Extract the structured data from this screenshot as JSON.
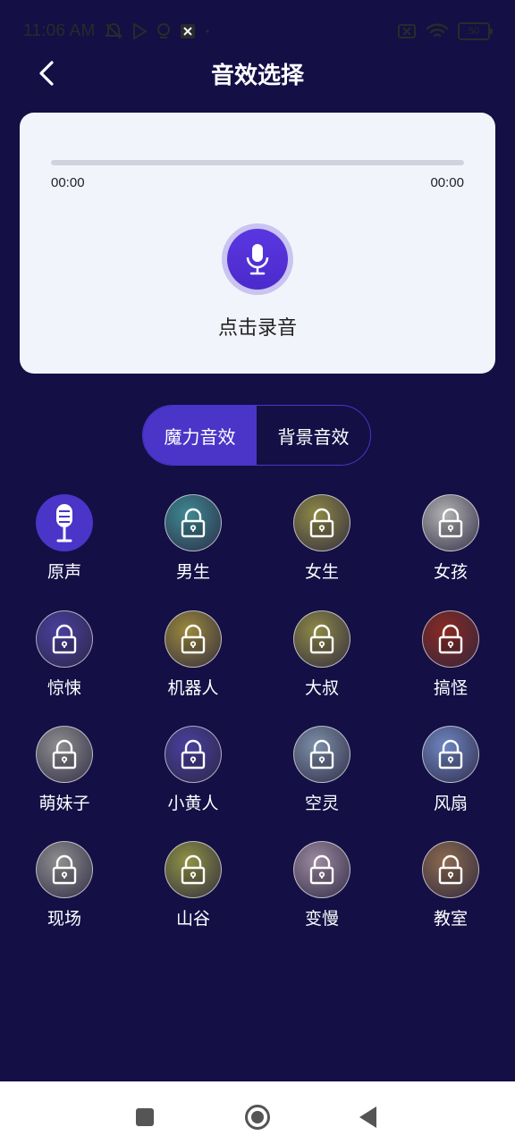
{
  "status": {
    "time": "11:06 AM",
    "battery": "50"
  },
  "header": {
    "title": "音效选择"
  },
  "recorder": {
    "time_start": "00:00",
    "time_end": "00:00",
    "label": "点击录音"
  },
  "tabs": [
    {
      "label": "魔力音效",
      "active": true
    },
    {
      "label": "背景音效",
      "active": false
    }
  ],
  "effects": [
    {
      "label": "原声",
      "color": "#4a35c8"
    },
    {
      "label": "男生",
      "color": "#3e8a93"
    },
    {
      "label": "女生",
      "color": "#8f8a45"
    },
    {
      "label": "女孩",
      "color": "#b3b3b3"
    },
    {
      "label": "惊悚",
      "color": "#4a3f9e"
    },
    {
      "label": "机器人",
      "color": "#9c8a3c"
    },
    {
      "label": "大叔",
      "color": "#8f8a45"
    },
    {
      "label": "搞怪",
      "color": "#8a2a22"
    },
    {
      "label": "萌妹子",
      "color": "#8f8f8f"
    },
    {
      "label": "小黄人",
      "color": "#4a3f9e"
    },
    {
      "label": "空灵",
      "color": "#7d90a8"
    },
    {
      "label": "风扇",
      "color": "#6f86c2"
    },
    {
      "label": "现场",
      "color": "#8f8f8f"
    },
    {
      "label": "山谷",
      "color": "#8f9443"
    },
    {
      "label": "变慢",
      "color": "#9d8aa0"
    },
    {
      "label": "教室",
      "color": "#8c6a4e"
    }
  ]
}
